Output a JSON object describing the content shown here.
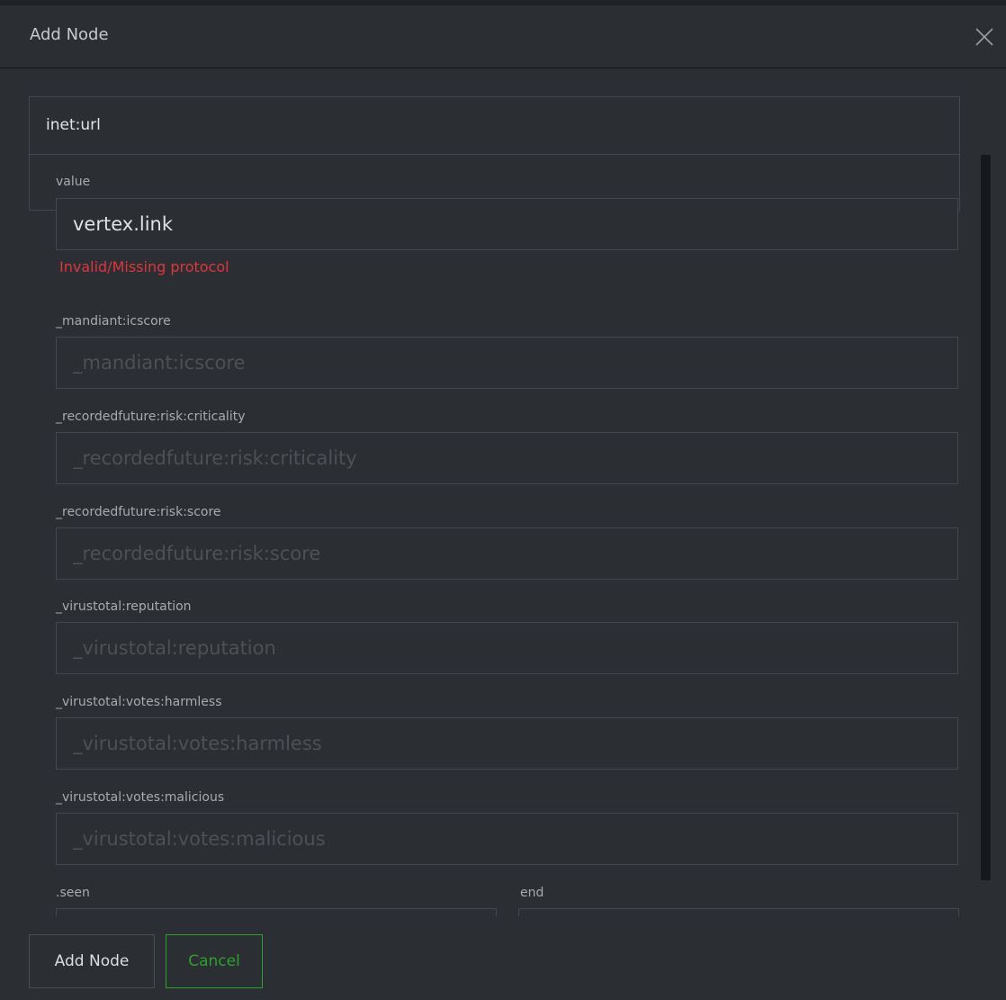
{
  "dialog": {
    "title": "Add Node",
    "close_icon": "close-icon"
  },
  "form": {
    "type_value": "inet:url",
    "value_label": "value",
    "value_input": "vertex.link",
    "value_error": "Invalid/Missing protocol",
    "fields": [
      {
        "label": "_mandiant:icscore",
        "placeholder": "_mandiant:icscore"
      },
      {
        "label": "_recordedfuture:risk:criticality",
        "placeholder": "_recordedfuture:risk:criticality"
      },
      {
        "label": "_recordedfuture:risk:score",
        "placeholder": "_recordedfuture:risk:score"
      },
      {
        "label": "_virustotal:reputation",
        "placeholder": "_virustotal:reputation"
      },
      {
        "label": "_virustotal:votes:harmless",
        "placeholder": "_virustotal:votes:harmless"
      },
      {
        "label": "_virustotal:votes:malicious",
        "placeholder": "_virustotal:votes:malicious"
      }
    ],
    "seen_label": ".seen",
    "end_label": "end"
  },
  "footer": {
    "add_label": "Add Node",
    "cancel_label": "Cancel"
  },
  "colors": {
    "background": "#2b2e33",
    "error": "#e0353b",
    "accent_green": "#2ea02e"
  }
}
